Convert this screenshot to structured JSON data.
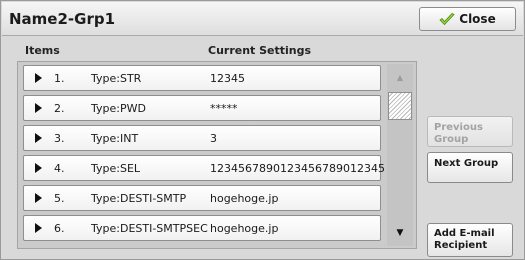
{
  "title": "Name2-Grp1",
  "close_label": "Close",
  "columns": {
    "items": "Items",
    "current_settings": "Current Settings"
  },
  "rows": [
    {
      "num": "1.",
      "type": "Type:STR",
      "value": "12345"
    },
    {
      "num": "2.",
      "type": "Type:PWD",
      "value": "*****"
    },
    {
      "num": "3.",
      "type": "Type:INT",
      "value": "3"
    },
    {
      "num": "4.",
      "type": "Type:SEL",
      "value": "1234567890123456789012345"
    },
    {
      "num": "5.",
      "type": "Type:DESTI-SMTP",
      "value": "hogehoge.jp"
    },
    {
      "num": "6.",
      "type": "Type:DESTI-SMTPSEC",
      "value": "hogehoge.jp"
    }
  ],
  "side": {
    "previous_group": "Previous Group",
    "next_group": "Next Group",
    "add_email": "Add E-mail Recipient"
  },
  "icons": {
    "close": "checkmark-icon",
    "row": "triangle-right-icon",
    "scroll_up": "arrow-up-icon",
    "scroll_down": "arrow-down-icon"
  },
  "colors": {
    "check_fill": "#9bd23a",
    "check_stroke": "#4f8a12"
  }
}
